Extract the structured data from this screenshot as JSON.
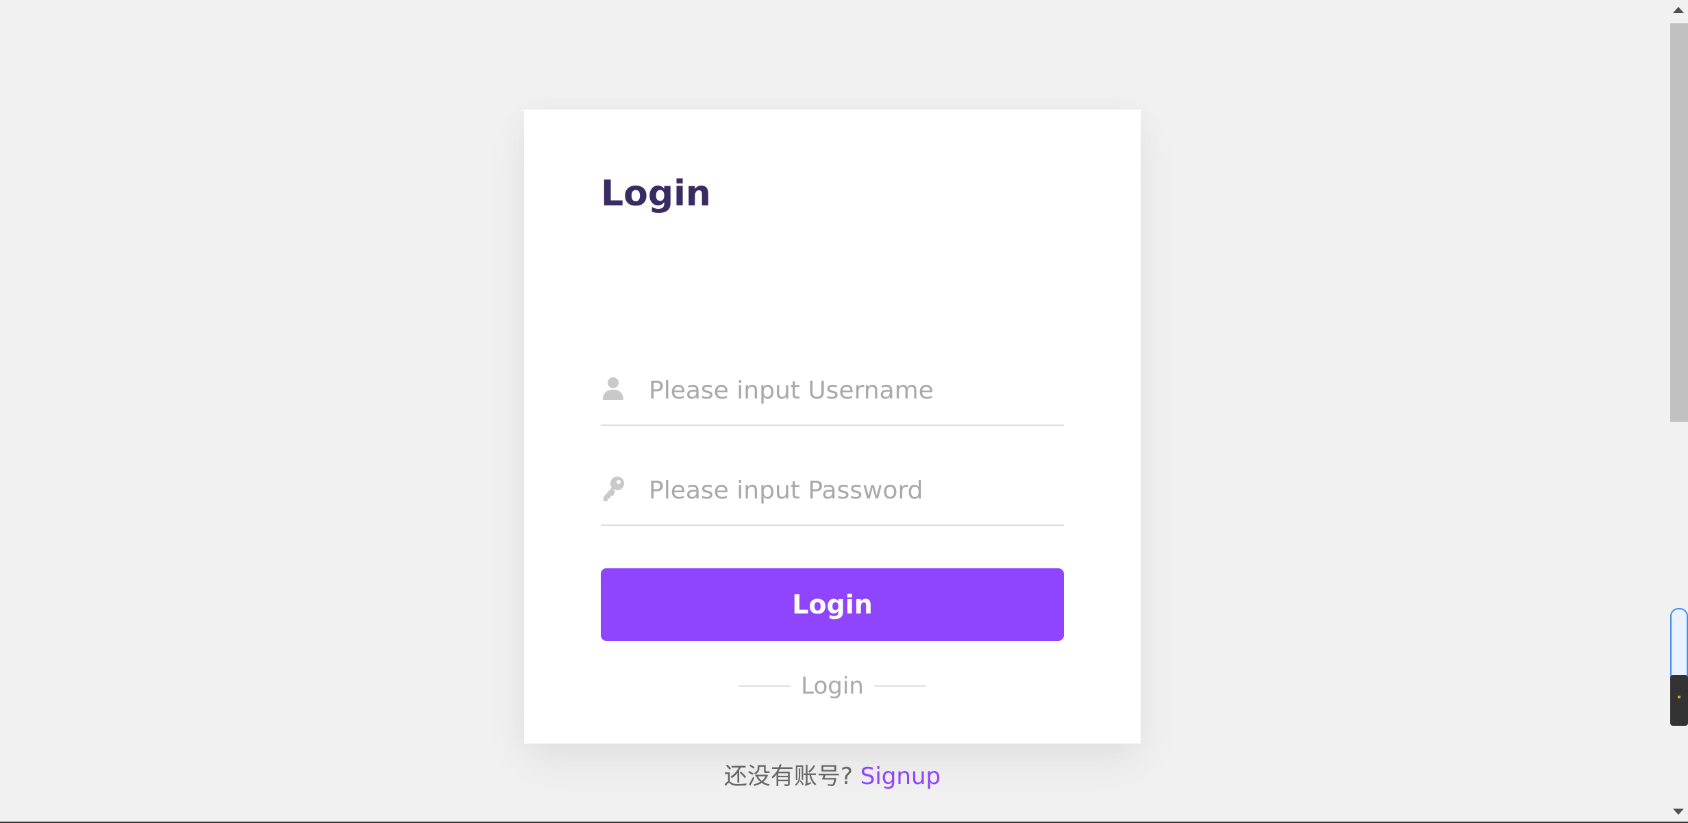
{
  "page": {
    "title": "Login"
  },
  "form": {
    "username": {
      "placeholder": "Please input Username",
      "value": ""
    },
    "password": {
      "placeholder": "Please input Password",
      "value": ""
    },
    "submit_label": "Login"
  },
  "divider": {
    "label": "Login"
  },
  "signup": {
    "prompt": "还没有账号? ",
    "link_label": "Signup"
  },
  "icons": {
    "username": "user-icon",
    "password": "key-icon"
  },
  "colors": {
    "accent": "#8f45fd",
    "title": "#3a2b63",
    "background": "#f1f1f1",
    "card": "#ffffff"
  }
}
